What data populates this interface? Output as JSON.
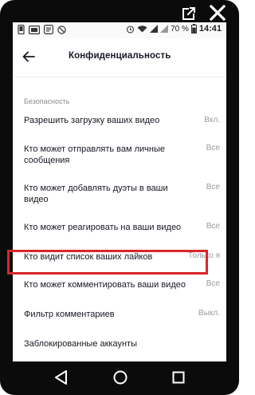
{
  "status_bar": {
    "battery_pct": "70 %",
    "time": "14:41"
  },
  "header": {
    "title": "Конфиденциальность"
  },
  "section_security": "Безопасность",
  "settings": [
    {
      "label": "Разрешить загрузку ваших видео",
      "value": "Вкл."
    },
    {
      "label": "Кто может отправлять вам личные сообщения",
      "value": "Все"
    },
    {
      "label": "Кто может добавлять дуэты в ваши видео",
      "value": "Все"
    },
    {
      "label": "Кто может реагировать на ваши видео",
      "value": "Все"
    },
    {
      "label": "Кто видит список ваших лайков",
      "value": "Только я"
    },
    {
      "label": "Кто может комментировать ваши видео",
      "value": "Все"
    },
    {
      "label": "Фильтр комментариев",
      "value": "Выкл."
    },
    {
      "label": "Заблокированные аккаунты",
      "value": ""
    }
  ],
  "colors": {
    "highlight": "#d9262c",
    "text": "#161823",
    "muted": "#9a9a9e"
  }
}
